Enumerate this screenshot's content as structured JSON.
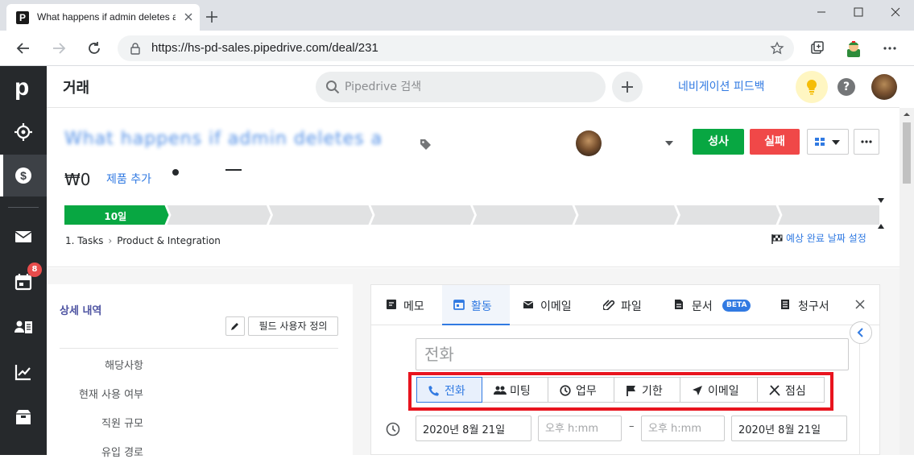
{
  "browser": {
    "tab_title": "What happens if admin deletes a",
    "favicon_letter": "P",
    "url": "https://hs-pd-sales.pipedrive.com/deal/231"
  },
  "header": {
    "title": "거래",
    "search_placeholder": "Pipedrive 검색",
    "nav_feedback": "네비게이션 피드백",
    "help": "?"
  },
  "sidebar": {
    "logo": "p",
    "activity_badge": "8"
  },
  "deal": {
    "title": "What happens if admin deletes a",
    "value": "₩0",
    "add_products": "제품 추가",
    "won_label": "성사",
    "lost_label": "실패",
    "stage_current": "10일",
    "pipeline": "1. Tasks",
    "stage_name": "Product & Integration",
    "expected_close": "예상 완료 날짜 설정",
    "stage_count": 8,
    "active_stages": 1
  },
  "details": {
    "title": "상세 내역",
    "customize_fields": "필드 사용자 정의",
    "fields": [
      "해당사항",
      "현재 사용 여부",
      "직원 규모",
      "유입 경로"
    ]
  },
  "activity_panel": {
    "tabs": [
      {
        "label": "메모",
        "icon": "note-icon"
      },
      {
        "label": "활동",
        "icon": "calendar-icon"
      },
      {
        "label": "이메일",
        "icon": "mail-icon"
      },
      {
        "label": "파일",
        "icon": "paperclip-icon"
      },
      {
        "label": "문서",
        "icon": "document-icon"
      },
      {
        "label": "청구서",
        "icon": "invoice-icon"
      }
    ],
    "beta": "BETA",
    "subject_placeholder": "전화",
    "types": [
      {
        "label": "전화",
        "icon": "phone-icon"
      },
      {
        "label": "미팅",
        "icon": "people-icon"
      },
      {
        "label": "업무",
        "icon": "clock-icon"
      },
      {
        "label": "기한",
        "icon": "flag-icon"
      },
      {
        "label": "이메일",
        "icon": "send-icon"
      },
      {
        "label": "점심",
        "icon": "utensils-icon"
      }
    ],
    "start_date": "2020년 8월 21일",
    "start_time_placeholder": "오후 h:mm",
    "end_time_placeholder": "오후 h:mm",
    "end_date": "2020년 8월 21일",
    "dash": "–"
  },
  "colors": {
    "accent": "#317ae2",
    "won": "#08a742",
    "lost": "#f04848",
    "highlight_outline": "#e8141e",
    "sidebar": "#26292c"
  }
}
